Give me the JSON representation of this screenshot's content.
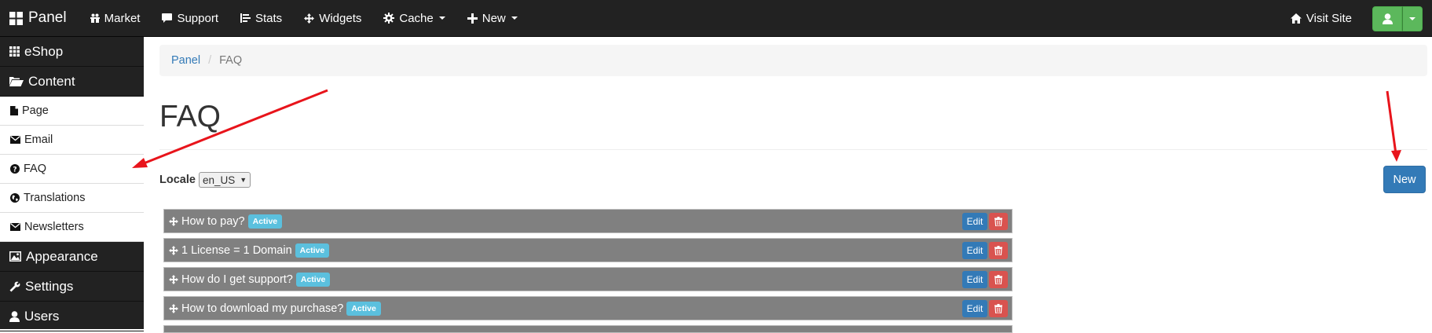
{
  "navbar": {
    "brand": "Panel",
    "items": [
      {
        "label": "Market"
      },
      {
        "label": "Support"
      },
      {
        "label": "Stats"
      },
      {
        "label": "Widgets"
      },
      {
        "label": "Cache"
      },
      {
        "label": "New"
      }
    ],
    "visit_site": "Visit Site"
  },
  "sidebar": {
    "sections": [
      {
        "label": "eShop"
      },
      {
        "label": "Content"
      }
    ],
    "subitems": [
      {
        "label": "Page"
      },
      {
        "label": "Email"
      },
      {
        "label": "FAQ"
      },
      {
        "label": "Translations"
      },
      {
        "label": "Newsletters"
      }
    ],
    "sections_after": [
      {
        "label": "Appearance"
      },
      {
        "label": "Settings"
      },
      {
        "label": "Users"
      }
    ]
  },
  "breadcrumb": {
    "root": "Panel",
    "current": "FAQ"
  },
  "page": {
    "title": "FAQ",
    "locale_label": "Locale",
    "locale_value": "en_US",
    "new_button": "New"
  },
  "faqs": [
    {
      "question": "How to pay?",
      "status": "Active",
      "edit": "Edit"
    },
    {
      "question": "1 License = 1 Domain",
      "status": "Active",
      "edit": "Edit"
    },
    {
      "question": "How do I get support?",
      "status": "Active",
      "edit": "Edit"
    },
    {
      "question": "How to download my purchase?",
      "status": "Active",
      "edit": "Edit"
    }
  ],
  "colors": {
    "navbar": "#222222",
    "primary": "#337ab7",
    "success": "#5cb85c",
    "danger": "#d9534f",
    "info": "#5bc0de",
    "row": "#808080",
    "annotation": "#e8141b"
  }
}
